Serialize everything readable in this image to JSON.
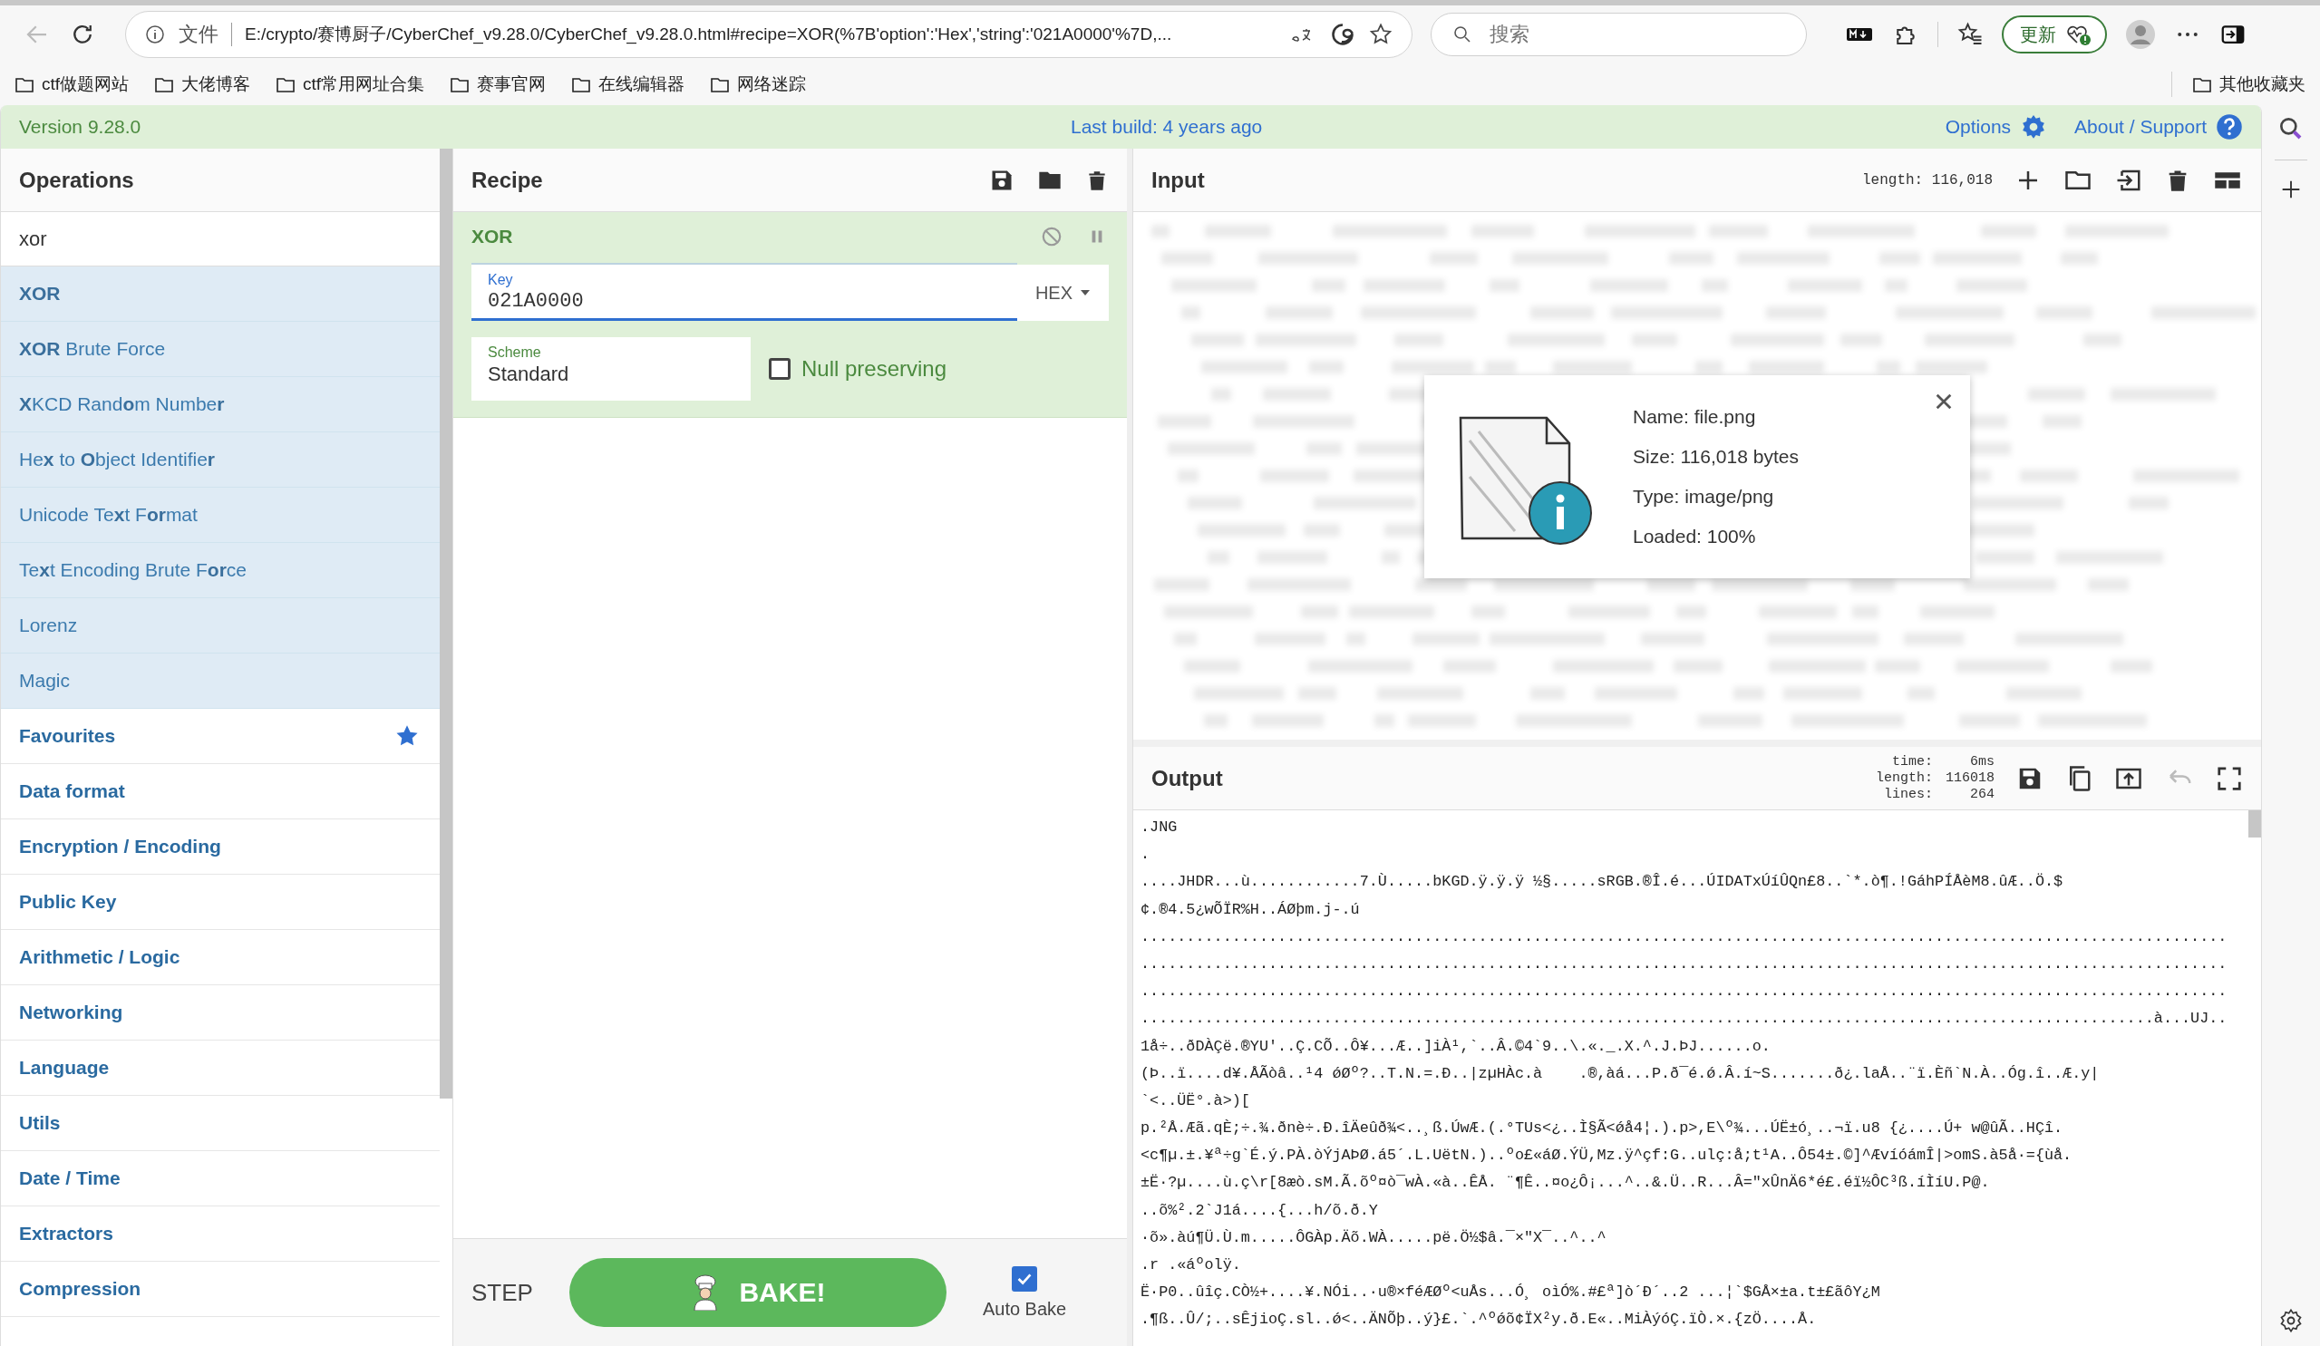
{
  "browser": {
    "address": {
      "security_label": "文件",
      "url": "E:/crypto/赛博厨子/CyberChef_v9.28.0/CyberChef_v9.28.0.html#recipe=XOR(%7B'option':'Hex','string':'021A0000'%7D,..."
    },
    "search_placeholder": "搜索",
    "update_button": "更新",
    "bookmarks": [
      "ctf做题网站",
      "大佬博客",
      "ctf常用网址合集",
      "赛事官网",
      "在线编辑器",
      "网络迷踪"
    ],
    "other_bookmarks": "其他收藏夹"
  },
  "banner": {
    "version": "Version 9.28.0",
    "last_build": "Last build: 4 years ago",
    "options": "Options",
    "about": "About / Support"
  },
  "operations": {
    "title": "Operations",
    "search_value": "xor",
    "items": [
      {
        "kind": "result",
        "label": "**XOR**"
      },
      {
        "kind": "result",
        "label": "**XOR** Brute Force"
      },
      {
        "kind": "result",
        "label": "**X**KCD Rand**o**m Numbe**r**"
      },
      {
        "kind": "result",
        "label": "He**x** to **O**bject Identifie**r**"
      },
      {
        "kind": "result",
        "label": "Unicode Te**x**t F**or**mat"
      },
      {
        "kind": "result",
        "label": "Te**x**t Encoding Brute F**or**ce"
      },
      {
        "kind": "result",
        "label": "Lorenz"
      },
      {
        "kind": "result",
        "label": "Magic"
      },
      {
        "kind": "favourites",
        "label": "Favourites"
      },
      {
        "kind": "category",
        "label": "Data format"
      },
      {
        "kind": "category",
        "label": "Encryption / Encoding"
      },
      {
        "kind": "category",
        "label": "Public Key"
      },
      {
        "kind": "category",
        "label": "Arithmetic / Logic"
      },
      {
        "kind": "category",
        "label": "Networking"
      },
      {
        "kind": "category",
        "label": "Language"
      },
      {
        "kind": "category",
        "label": "Utils"
      },
      {
        "kind": "category",
        "label": "Date / Time"
      },
      {
        "kind": "category",
        "label": "Extractors"
      },
      {
        "kind": "category",
        "label": "Compression"
      }
    ]
  },
  "recipe": {
    "title": "Recipe",
    "operation": {
      "name": "XOR",
      "key": {
        "label": "Key",
        "value": "021A0000",
        "encoding": "HEX"
      },
      "scheme": {
        "label": "Scheme",
        "value": "Standard"
      },
      "null_preserving": {
        "label": "Null preserving",
        "checked": false
      }
    },
    "step": "STEP",
    "bake": "BAKE!",
    "auto_bake": {
      "label": "Auto Bake",
      "checked": true
    }
  },
  "input": {
    "title": "Input",
    "length": "length: 116,018",
    "file": {
      "name": "Name: file.png",
      "size": "Size: 116,018 bytes",
      "type": "Type: image/png",
      "loaded": "Loaded: 100%"
    }
  },
  "output": {
    "title": "Output",
    "stats": [
      {
        "label": "time:",
        "value": "6ms"
      },
      {
        "label": "length:",
        "value": "116018"
      },
      {
        "label": "lines:",
        "value": "264"
      }
    ],
    "lines": [
      ".JNG",
      ".",
      "....JHDR...ù............7.Ù.....bKGD.ÿ.ÿ.ÿ ½§.....sRGB.®Î.é...ÚIDATxÚíÛQn£8..`*.ò¶.!GáhPÍÅèM8.ûÆ..Ö.$",
      "¢.®4.5¿wÕÏR%H..ÁØþm.j-.ú",
      ".......................................................................................................................",
      ".......................................................................................................................",
      ".......................................................................................................................",
      "...............................................................................................................à...UJ..",
      "1å÷..ðDÀÇë.®YU'..Ç.CÕ..Ô¥...Æ..]iÀ¹,`..Â.©4`9..\\.«._.X.^.J.ÞJ......o.",
      "(Þ..ï....d¥.ÅÃòâ..¹4 ǿØº?..T.N.=.Ð..|zµHÀc.à    .®,àá...P.ð¯é.ǿ.Â.í~S.......ð¿.laÅ..¨ï.Èñ`N.À..Óg.î..Æ.y|",
      "`<..ÜË°.à>)[",
      "p.²Å.Æã.qÈ;÷.¾.ðnè÷.Ð.îÄeûð¾<..¸ß.ÚwÆ.(.°TUs<¿..Ì§Ã<ǿå4¦.).p>,E\\º¾...ÚË±ó¸..¬ï.u8 {¿....Ú+ w@ûÃ..HÇî.",
      "<c¶µ.±.¥ª÷g`É.ý.PÀ.òÝjAÞØ.á5´.L.UëtN.)..ºo£«áØ.ÝÜ,Mz.ÿ^çf:G..ulç:å;t¹A..Ô54±.©]^ÆvíóámÎ|>omS.à5å·={ùå.",
      "±Ë·?µ....ù.ç\\r[8æò.sM.Ã.õº¤ò¯wÀ.«à..ÊÅ. ¨¶Ê..¤o¿Ô¡...^..&.Ü..R...Â=\"xÛnÄ6*é£.éï½ÔC³ß.íÌíU.P@.",
      "..õ%².2`J1á....{...h/õ.ð.Y",
      "·õ».àú¶Ü.Ù.m.....ÔGÀp.Äõ.WÀ.....pë.Ö½$â.¯×\"X¯..^..^",
      ".r .«áºolÿ.",
      "Ë·P0..ûîç.CÒ½+....¥.NÓi..·u®×féÆØº<uÅs...Ó¸ oìÓ%.#£ª]ò´Ð´..2 ...¦`$GÅ×±a.t±£ãôY¿M",
      ".¶ß..Û/;..sÊjioÇ.sl..ǿ<..ÄNÕþ..ý}£.`.^ºǿõ¢ÏX²y.ð.E«..MiÀýóÇ.ïÒ.×.{zÖ....Å."
    ]
  }
}
